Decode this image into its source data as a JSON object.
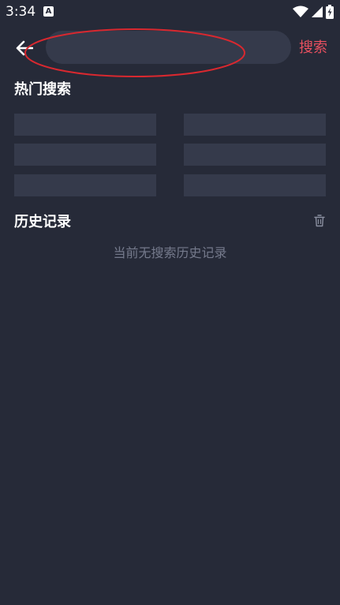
{
  "status_bar": {
    "time": "3:34",
    "notification_letter": "A",
    "icons": [
      "wifi-icon",
      "signal-icon",
      "battery-charging-icon"
    ]
  },
  "top_bar": {
    "back_icon": "arrow-left-icon",
    "search_input": {
      "value": "",
      "placeholder": ""
    },
    "search_button_label": "搜索",
    "search_button_color": "#e8505f",
    "annotation_color": "#d9282f"
  },
  "hot_search": {
    "title": "热门搜索",
    "items": [
      {
        "label": ""
      },
      {
        "label": ""
      },
      {
        "label": ""
      },
      {
        "label": ""
      },
      {
        "label": ""
      },
      {
        "label": ""
      }
    ]
  },
  "history": {
    "title": "历史记录",
    "clear_icon": "trash-icon",
    "empty_text": "当前无搜索历史记录"
  },
  "colors": {
    "background": "#262a38",
    "surface": "#353a4b",
    "muted_text": "#757a8c",
    "accent": "#e8505f"
  }
}
